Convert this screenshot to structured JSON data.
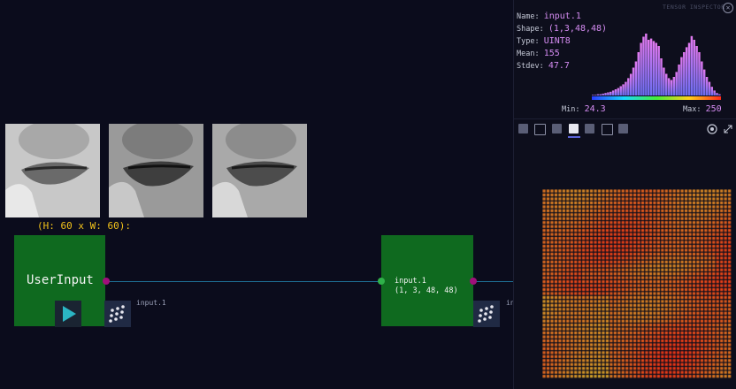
{
  "canvas": {
    "dimension_label": "(H: 60 x W: 60):",
    "nodes": {
      "user_input": {
        "title": "UserInput",
        "output_label": "input.1"
      },
      "input_node": {
        "name": "input.1",
        "shape": "(1, 3, 48, 48)",
        "output_label": "in"
      }
    },
    "thumbnails": [
      "face-crop-1",
      "face-crop-2",
      "face-crop-3"
    ]
  },
  "inspector": {
    "title": "TENSOR INSPECTOR",
    "stats": [
      {
        "key": "Name:",
        "value": "input.1"
      },
      {
        "key": "Shape:",
        "value": "(1,3,48,48)"
      },
      {
        "key": "Type:",
        "value": "UINT8"
      },
      {
        "key": "Mean:",
        "value": "155"
      },
      {
        "key": "Stdev:",
        "value": "47.7"
      }
    ],
    "min_label": "Min:",
    "min_value": "24.3",
    "max_label": "Max:",
    "max_value": "250",
    "histogram": [
      1,
      1,
      2,
      2,
      3,
      4,
      5,
      6,
      8,
      10,
      12,
      15,
      18,
      22,
      28,
      35,
      45,
      55,
      70,
      85,
      95,
      100,
      90,
      92,
      88,
      85,
      80,
      60,
      45,
      35,
      28,
      25,
      30,
      38,
      50,
      62,
      70,
      78,
      85,
      96,
      90,
      80,
      70,
      55,
      42,
      30,
      22,
      14,
      8,
      4,
      2
    ],
    "colors": {
      "accent": "#d58cf2",
      "node_green": "#0f6a1f",
      "port_magenta": "#a0107a",
      "port_green": "#2fb24a",
      "tab_underline": "#5b63d8"
    }
  }
}
